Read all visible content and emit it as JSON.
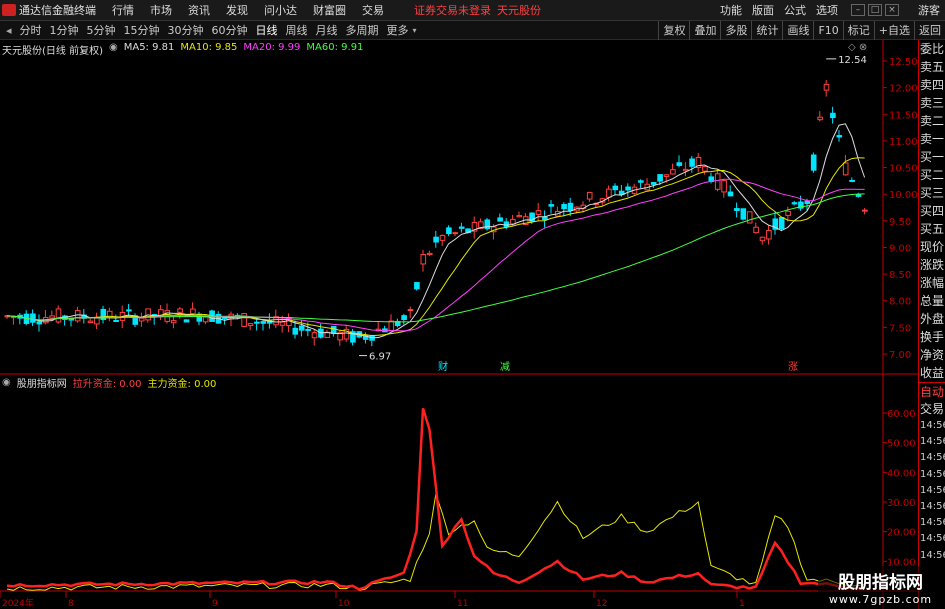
{
  "app_title": "通达信金融终端",
  "menu": [
    "行情",
    "市场",
    "资讯",
    "发现",
    "问小达",
    "财富圈",
    "交易"
  ],
  "warning": "证券交易未登录",
  "stock_name": "天元股份",
  "right_menu": [
    "功能",
    "版面",
    "公式",
    "选项"
  ],
  "guest": "游客",
  "periods": [
    "分时",
    "1分钟",
    "5分钟",
    "15分钟",
    "30分钟",
    "60分钟",
    "日线",
    "周线",
    "月线",
    "多周期",
    "更多"
  ],
  "active_period": "日线",
  "toolbar_right": [
    "复权",
    "叠加",
    "多股",
    "统计",
    "画线",
    "F10",
    "标记",
    "+自选",
    "返回"
  ],
  "chart_title": "天元股份(日线 前复权)",
  "ma": {
    "ma5": "MA5: 9.81",
    "ma10": "MA10: 9.85",
    "ma20": "MA20: 9.99",
    "ma60": "MA60: 9.91"
  },
  "indicator": {
    "name": "股朋指标网",
    "label1": "拉升资金: 0.00",
    "label2": "主力资金: 0.00"
  },
  "colors": {
    "up": "#ff4040",
    "down": "#00e5ff",
    "ma5": "#dddddd",
    "ma10": "#e6e600",
    "ma20": "#ff40ff",
    "ma60": "#40ff40",
    "axis": "#c00000"
  },
  "right_panel": [
    "委比",
    "卖五",
    "卖四",
    "卖三",
    "卖二",
    "卖一",
    "买一",
    "买二",
    "买三",
    "买四",
    "买五",
    "现价",
    "涨跌",
    "涨幅",
    "总量",
    "外盘",
    "换手",
    "净资",
    "收益"
  ],
  "right_panel2": [
    "自动",
    "交易"
  ],
  "times": [
    "14:56",
    "14:56",
    "14:56",
    "14:56",
    "14:56",
    "14:56",
    "14:56",
    "14:56",
    "14:56"
  ],
  "price_ticks": [
    "12.50",
    "12.00",
    "11.50",
    "11.00",
    "10.50",
    "10.00",
    "9.50",
    "9.00",
    "8.50",
    "8.00",
    "7.50",
    "7.00"
  ],
  "ind_ticks": [
    "60.00",
    "50.00",
    "40.00",
    "30.00",
    "20.00",
    "10.00"
  ],
  "hi_label": "12.54",
  "lo_label": "6.97",
  "event_marks": [
    {
      "text": "财",
      "color": "#00e5ff"
    },
    {
      "text": "减",
      "color": "#40ff40"
    },
    {
      "text": "涨",
      "color": "#ff4040"
    }
  ],
  "date_labels": [
    "2024年",
    "8",
    "9",
    "10",
    "11",
    "12",
    "1"
  ],
  "watermark": {
    "cn": "股朋指标网",
    "url": "www.7gpzb.com"
  }
}
